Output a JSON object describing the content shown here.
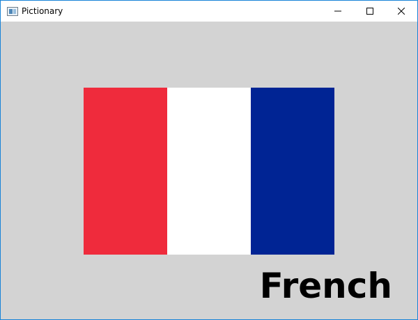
{
  "window": {
    "title": "Pictionary",
    "icon": "app-window-icon"
  },
  "controls": {
    "minimize_icon": "minimize-icon",
    "maximize_icon": "maximize-icon",
    "close_icon": "close-icon"
  },
  "colors": {
    "client_background": "#d3d3d3",
    "stripe_red": "#ef2b3c",
    "stripe_white": "#ffffff",
    "stripe_blue": "#002494"
  },
  "flag": {
    "stripes": [
      "red",
      "white",
      "blue"
    ]
  },
  "caption": {
    "text": "French"
  }
}
